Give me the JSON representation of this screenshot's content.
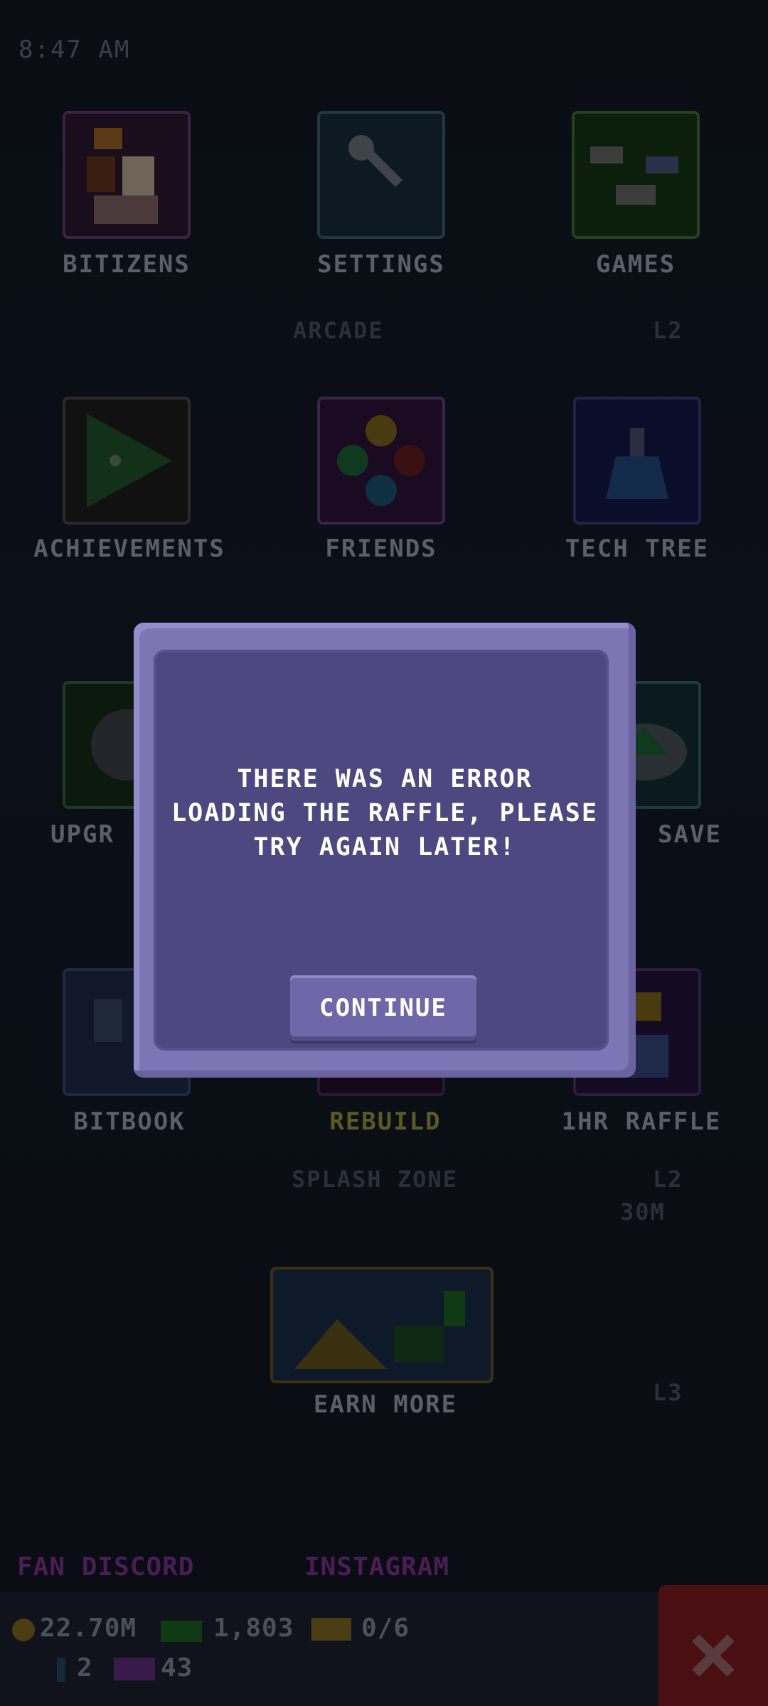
{
  "status": {
    "time": "8:47 AM"
  },
  "menu": {
    "tiles": [
      {
        "label": "BITIZENS",
        "icon": "bitizens-icon"
      },
      {
        "label": "SETTINGS",
        "icon": "wrench-icon"
      },
      {
        "label": "GAMES",
        "icon": "games-icon"
      },
      {
        "label": "ACHIEVEMENTS",
        "icon": "play-icon"
      },
      {
        "label": "FRIENDS",
        "icon": "smileys-icon"
      },
      {
        "label": "TECH TREE",
        "icon": "flask-icon"
      },
      {
        "label": "UPGR",
        "icon": "gear-icon"
      },
      {
        "label": "SAVE",
        "icon": "cloud-icon"
      },
      {
        "label": "BITBOOK",
        "icon": "bitbook-icon"
      },
      {
        "label": "REBUILD",
        "icon": "rebuild-icon"
      },
      {
        "label": "1HR RAFFLE",
        "icon": "raffle-icon"
      }
    ],
    "earn_more": "EARN MORE"
  },
  "background_text": {
    "arcade": "ARCADE",
    "splash_zone": "SPLASH ZONE",
    "level_top": "L2",
    "level_mid": "L2",
    "amount": "30M",
    "level_bottom": "L3"
  },
  "links": {
    "discord": "FAN DISCORD",
    "instagram": "INSTAGRAM"
  },
  "currency": {
    "coins": "22.70M",
    "bux": "1,803",
    "tickets": "0/6",
    "keys": "2",
    "vip": "43"
  },
  "dialog": {
    "message_line1": "THERE WAS AN ERROR",
    "message_line2": "LOADING THE RAFFLE, PLEASE",
    "message_line3": "TRY AGAIN LATER!",
    "button": "CONTINUE"
  },
  "colors": {
    "dialog_bg": "#4d4980",
    "dialog_border": "#7d76b4",
    "button": "#6e68a8"
  }
}
